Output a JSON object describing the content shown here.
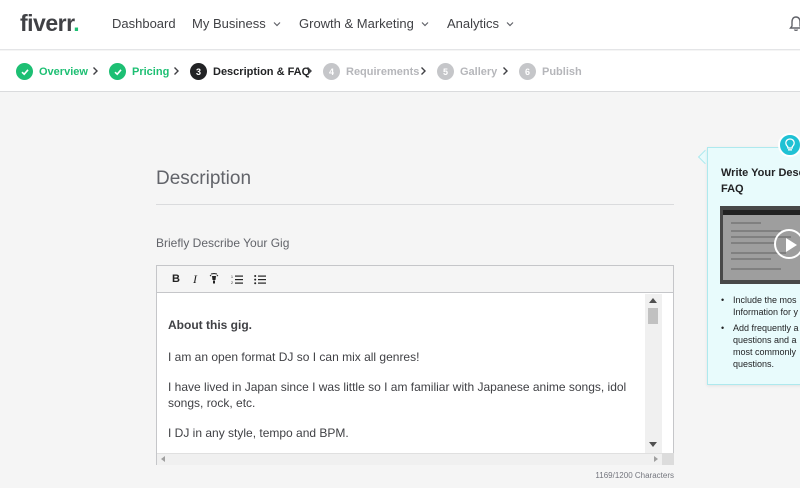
{
  "nav": {
    "logo": "fiverr",
    "logo_dot": ".",
    "items": [
      {
        "label": "Dashboard"
      },
      {
        "label": "My Business"
      },
      {
        "label": "Growth & Marketing"
      },
      {
        "label": "Analytics"
      }
    ]
  },
  "stepper": {
    "steps": [
      {
        "num": "1",
        "label": "Overview",
        "state": "done"
      },
      {
        "num": "2",
        "label": "Pricing",
        "state": "done"
      },
      {
        "num": "3",
        "label": "Description & FAQ",
        "state": "active"
      },
      {
        "num": "4",
        "label": "Requirements",
        "state": "todo"
      },
      {
        "num": "5",
        "label": "Gallery",
        "state": "todo"
      },
      {
        "num": "6",
        "label": "Publish",
        "state": "todo"
      }
    ]
  },
  "main": {
    "section_title": "Description",
    "field_label": "Briefly Describe Your Gig",
    "toolbar": {
      "bold": "B",
      "italic": "I"
    },
    "content": {
      "p1": "About this gig.",
      "p2": "I am an open format DJ so I can mix all genres!",
      "p3": "I have lived in Japan since I was little so I am familiar with Japanese anime songs, idol songs, rock, etc.",
      "p4": "I DJ in any style, tempo and BPM."
    },
    "counter": "1169/1200 Characters"
  },
  "tips": {
    "title_line1": "Write Your Desc",
    "title_line2": "FAQ",
    "tip1_line1": "Include the mos",
    "tip1_line2": "Information for y",
    "tip2_line1": "Add frequently a",
    "tip2_line2": "questions and a",
    "tip2_line3": "most commonly",
    "tip2_line4": "questions."
  },
  "colors": {
    "accent": "#1dbf73",
    "active_step": "#222325",
    "todo_step": "#c5c6c9",
    "tips_bg": "#e8fbfc",
    "tips_icon": "#1fc1d4"
  },
  "icons": {
    "completed_step": "check-icon",
    "separator": "chevron-right-icon",
    "dropdown": "chevron-down-icon",
    "notifications": "bell-icon",
    "tips": "lightbulb-icon",
    "video": "play-icon"
  }
}
